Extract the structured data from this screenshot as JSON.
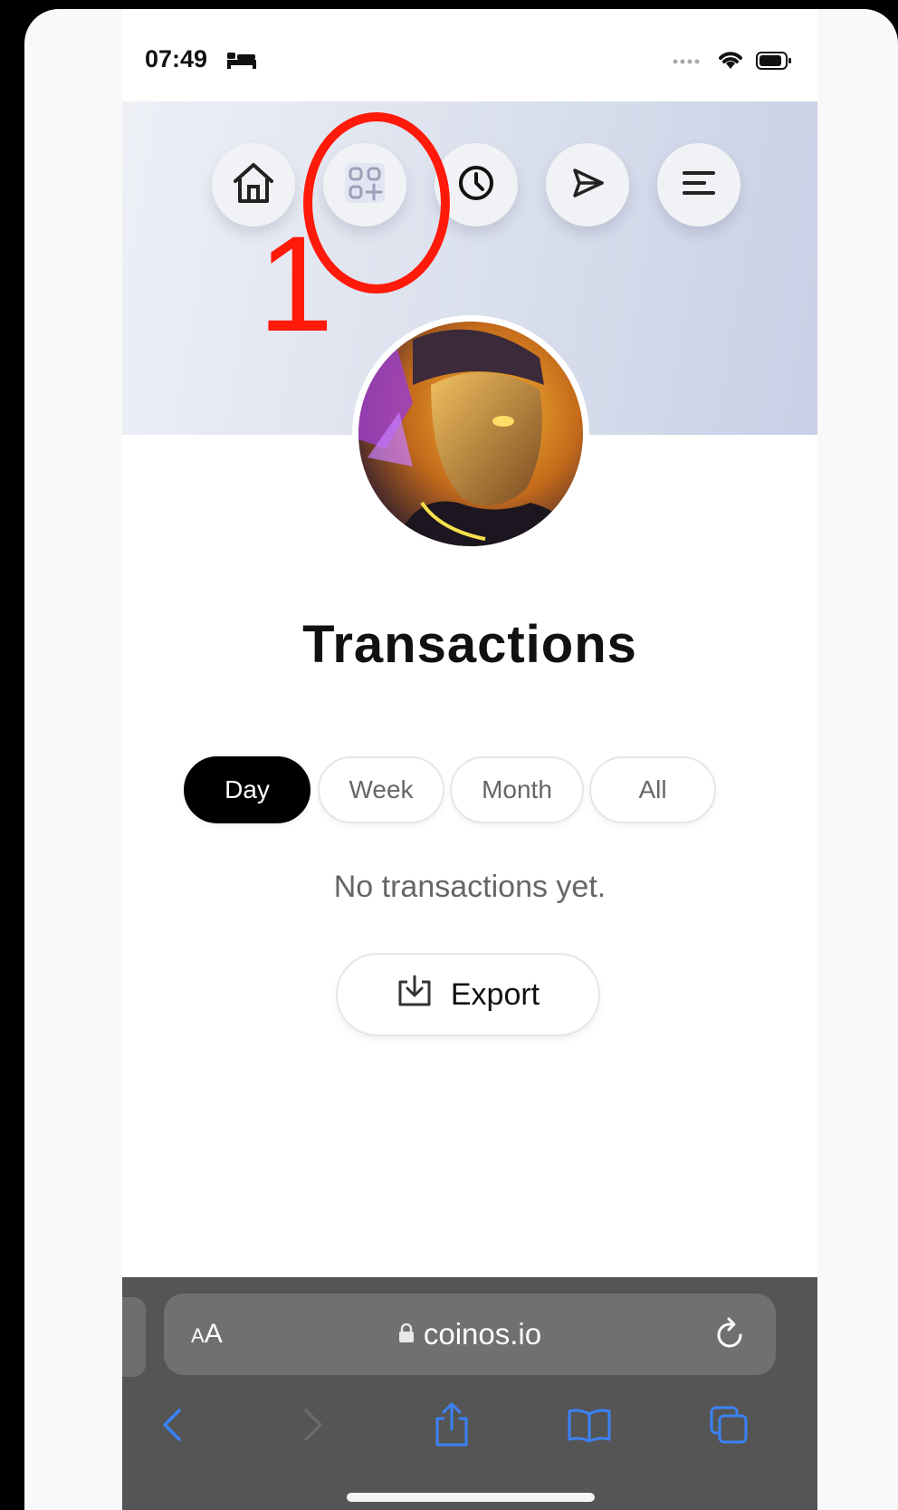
{
  "status_bar": {
    "time": "07:49",
    "icons": [
      "bed-icon",
      "signal-dots-icon",
      "wifi-icon",
      "battery-icon"
    ]
  },
  "nav": {
    "items": [
      {
        "name": "home",
        "icon": "home-icon"
      },
      {
        "name": "apps",
        "icon": "grid-plus-icon"
      },
      {
        "name": "history",
        "icon": "clock-icon"
      },
      {
        "name": "send",
        "icon": "send-icon"
      },
      {
        "name": "menu",
        "icon": "menu-icon"
      }
    ]
  },
  "annotation": {
    "number": "1",
    "color": "#ff1a0a"
  },
  "page": {
    "title": "Transactions",
    "tabs": [
      {
        "label": "Day",
        "active": true
      },
      {
        "label": "Week",
        "active": false
      },
      {
        "label": "Month",
        "active": false
      },
      {
        "label": "All",
        "active": false
      }
    ],
    "empty_message": "No transactions yet.",
    "export_label": "Export"
  },
  "browser": {
    "text_size_label": "AA",
    "url": "coinos.io",
    "toolbar": [
      "back-icon",
      "forward-icon",
      "share-icon",
      "bookmarks-icon",
      "tabs-icon"
    ]
  },
  "colors": {
    "accent_active_tab": "#000000",
    "browser_chrome": "#555555",
    "browser_icon_blue": "#3b82f6"
  }
}
